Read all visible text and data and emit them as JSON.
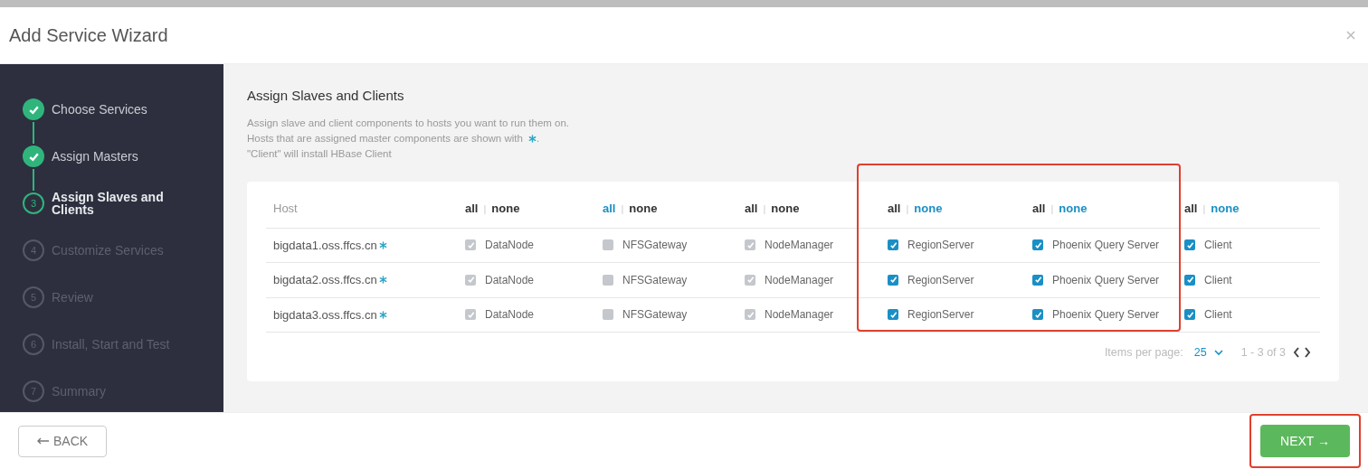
{
  "modal": {
    "title": "Add Service Wizard"
  },
  "steps": [
    {
      "label": "Choose Services",
      "done": true,
      "current": false
    },
    {
      "label": "Assign Masters",
      "done": true,
      "current": false
    },
    {
      "number": "3",
      "label": "Assign Slaves and Clients",
      "done": false,
      "current": true
    },
    {
      "number": "4",
      "label": "Customize Services",
      "done": false,
      "current": false
    },
    {
      "number": "5",
      "label": "Review",
      "done": false,
      "current": false
    },
    {
      "number": "6",
      "label": "Install, Start and Test",
      "done": false,
      "current": false
    },
    {
      "number": "7",
      "label": "Summary",
      "done": false,
      "current": false
    }
  ],
  "section": {
    "title": "Assign Slaves and Clients",
    "description": [
      "Assign slave and client components to hosts you want to run them on.",
      "Hosts that are assigned master components are shown with",
      "\"Client\" will install HBase Client"
    ],
    "description_end": "."
  },
  "table": {
    "host_header": "Host",
    "separator": "|",
    "columns": [
      {
        "all": {
          "label": "all",
          "link": false
        },
        "none": {
          "label": "none",
          "link": false
        },
        "highlighted": false
      },
      {
        "all": {
          "label": "all",
          "link": true
        },
        "none": {
          "label": "none",
          "link": false
        },
        "highlighted": false
      },
      {
        "all": {
          "label": "all",
          "link": false
        },
        "none": {
          "label": "none",
          "link": false
        },
        "highlighted": false
      },
      {
        "all": {
          "label": "all",
          "link": false
        },
        "none": {
          "label": "none",
          "link": true
        },
        "highlighted": true
      },
      {
        "all": {
          "label": "all",
          "link": false
        },
        "none": {
          "label": "none",
          "link": true
        },
        "highlighted": true
      },
      {
        "all": {
          "label": "all",
          "link": false
        },
        "none": {
          "label": "none",
          "link": true
        },
        "highlighted": false
      }
    ],
    "rows": [
      {
        "host": "bigdata1.oss.ffcs.cn",
        "master": true,
        "cells": [
          {
            "label": "DataNode",
            "checked": true,
            "disabled": true
          },
          {
            "label": "NFSGateway",
            "checked": false,
            "disabled": true
          },
          {
            "label": "NodeManager",
            "checked": true,
            "disabled": true
          },
          {
            "label": "RegionServer",
            "checked": true,
            "disabled": false
          },
          {
            "label": "Phoenix Query Server",
            "checked": true,
            "disabled": false
          },
          {
            "label": "Client",
            "checked": true,
            "disabled": false
          }
        ]
      },
      {
        "host": "bigdata2.oss.ffcs.cn",
        "master": true,
        "cells": [
          {
            "label": "DataNode",
            "checked": true,
            "disabled": true
          },
          {
            "label": "NFSGateway",
            "checked": false,
            "disabled": true
          },
          {
            "label": "NodeManager",
            "checked": true,
            "disabled": true
          },
          {
            "label": "RegionServer",
            "checked": true,
            "disabled": false
          },
          {
            "label": "Phoenix Query Server",
            "checked": true,
            "disabled": false
          },
          {
            "label": "Client",
            "checked": true,
            "disabled": false
          }
        ]
      },
      {
        "host": "bigdata3.oss.ffcs.cn",
        "master": true,
        "cells": [
          {
            "label": "DataNode",
            "checked": true,
            "disabled": true
          },
          {
            "label": "NFSGateway",
            "checked": false,
            "disabled": true
          },
          {
            "label": "NodeManager",
            "checked": true,
            "disabled": true
          },
          {
            "label": "RegionServer",
            "checked": true,
            "disabled": false
          },
          {
            "label": "Phoenix Query Server",
            "checked": true,
            "disabled": false
          },
          {
            "label": "Client",
            "checked": true,
            "disabled": false
          }
        ]
      }
    ],
    "pagination": {
      "label": "Items per page:",
      "page_size": "25",
      "range": "1 - 3 of 3"
    }
  },
  "footer": {
    "back": "BACK",
    "next": "NEXT →",
    "next_highlighted": true
  }
}
